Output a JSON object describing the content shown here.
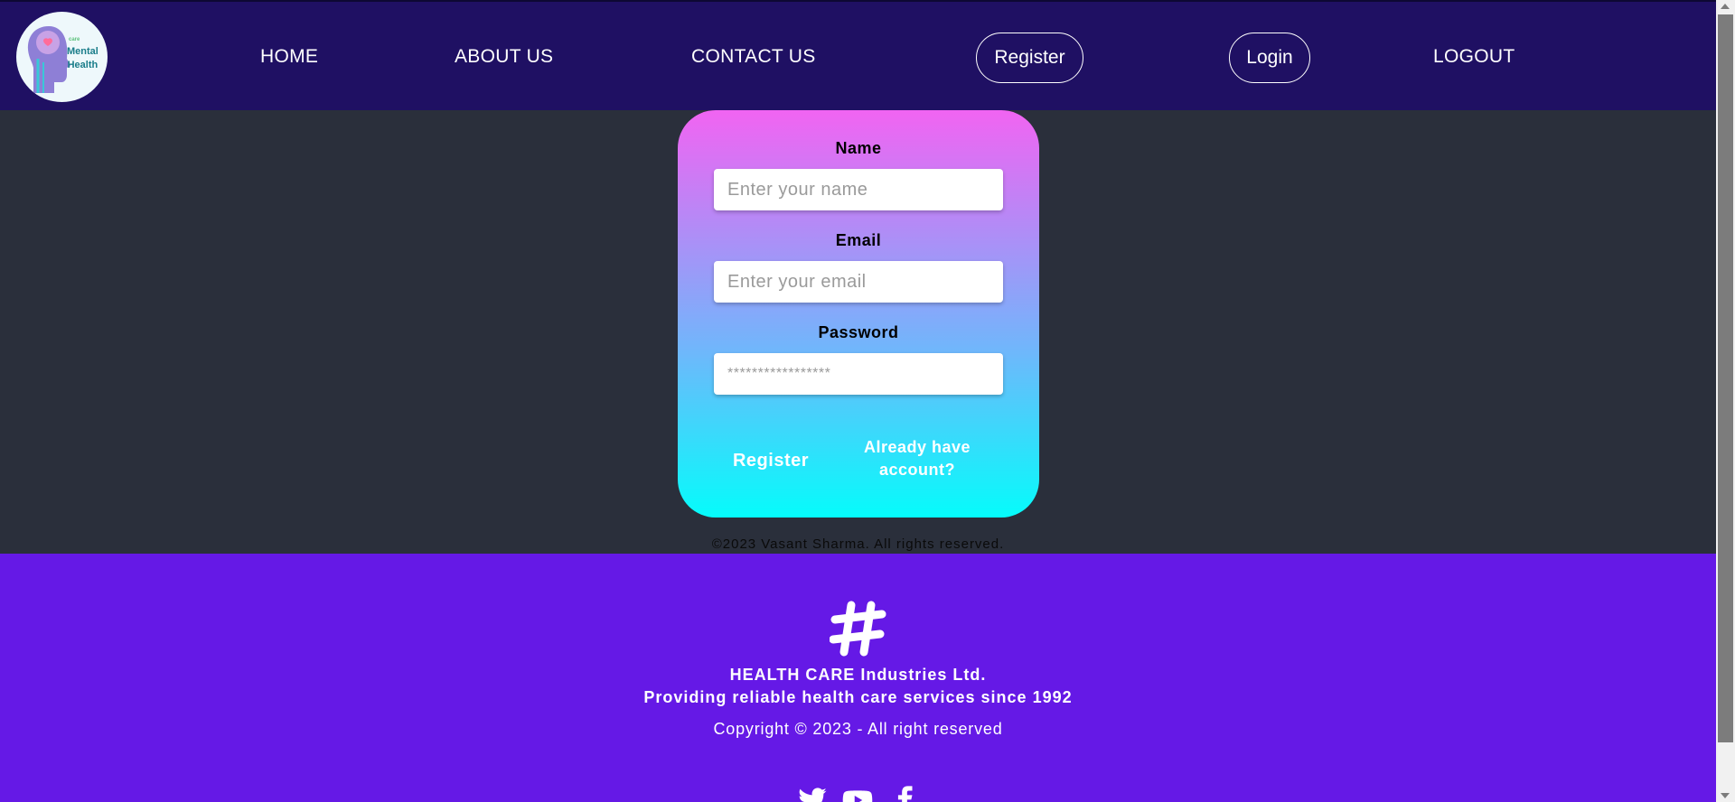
{
  "header": {
    "logo": {
      "small_text": "care",
      "line1": "Mental",
      "line2": "Health"
    },
    "nav": [
      {
        "label": "HOME"
      },
      {
        "label": "ABOUT US"
      },
      {
        "label": "CONTACT US"
      },
      {
        "label": "Register"
      },
      {
        "label": "Login"
      },
      {
        "label": "LOGOUT"
      }
    ]
  },
  "form": {
    "name_label": "Name",
    "name_placeholder": "Enter your name",
    "email_label": "Email",
    "email_placeholder": "Enter your email",
    "password_label": "Password",
    "password_placeholder": "*****************",
    "register_button": "Register",
    "login_link": "Already have account?"
  },
  "copyright_line": "©2023 Vasant Sharma. All rights reserved.",
  "footer": {
    "company": "HEALTH CARE Industries Ltd.",
    "tagline": "Providing reliable health care services since 1992",
    "copyright": "Copyright © 2023 - All right reserved",
    "social_icons": [
      "twitter-icon",
      "youtube-icon",
      "facebook-icon"
    ]
  },
  "colors": {
    "header_bg": "#1f1063",
    "page_bg": "#2a2f3b",
    "footer_bg": "#6519e6",
    "card_gradient_top": "#f164f2",
    "card_gradient_bottom": "#05fcfb"
  }
}
